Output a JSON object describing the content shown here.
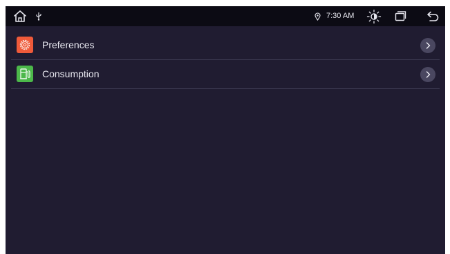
{
  "statusbar": {
    "time": "7:30 AM",
    "icons": [
      "home-icon",
      "usb-icon",
      "location-icon",
      "brightness-icon",
      "window-icon",
      "back-icon"
    ]
  },
  "colors": {
    "background": "#201c31",
    "statusbar": "#0c0b14",
    "preferences_icon": "#ef5a3a",
    "consumption_icon": "#4cb84a",
    "chevron_bg": "#4a4760",
    "divider": "#3d3a52"
  },
  "menu": {
    "items": [
      {
        "label": "Preferences",
        "icon": "gear-icon",
        "chevron": "chevron-right-icon"
      },
      {
        "label": "Consumption",
        "icon": "fuel-pump-icon",
        "chevron": "chevron-right-icon"
      }
    ]
  }
}
